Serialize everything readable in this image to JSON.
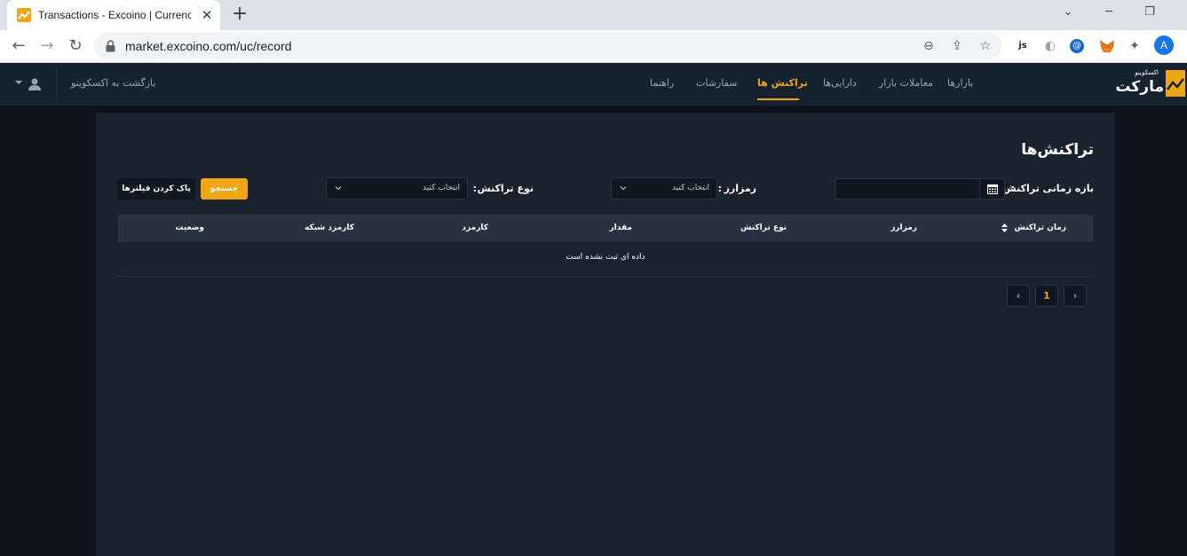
{
  "browser": {
    "tab_title": "Transactions - Excoino | Currency",
    "tab_close": "✕",
    "new_tab": "+",
    "url": "market.excoino.com/uc/record",
    "profile_initial": "A",
    "extensions": [
      "js-extension-icon",
      "circle-extension-icon",
      "at-extension-icon",
      "metamask-icon",
      "puzzle-icon"
    ]
  },
  "header": {
    "brand_small": "اکسکوینو",
    "brand_big": "مارکت",
    "nav": [
      {
        "label": "بازارها",
        "active": false
      },
      {
        "label": "معاملات بازار",
        "active": false
      },
      {
        "label": "دارایی‌ها",
        "active": false
      },
      {
        "label": "تراکنش ها",
        "active": true
      },
      {
        "label": "سفارشات",
        "active": false
      },
      {
        "label": "راهنما",
        "active": false
      }
    ],
    "back_link": "بازگشت به اکسکوینو"
  },
  "page": {
    "title": "تراکنش‌ها",
    "filters": {
      "date_range_label": "بازه زمانی تراکنش",
      "separator": ":",
      "currency_label": "رمزارز",
      "currency_value": "انتخاب کنید",
      "type_label": "نوع تراکنش",
      "type_value": "انتخاب کنید",
      "search_button": "جستجو",
      "clear_button": "پاک کردن فیلترها"
    },
    "table": {
      "columns": [
        "زمان تراکنش",
        "رمزارز",
        "نوع تراکنش",
        "مقدار",
        "کارمزد",
        "کارمزد شبکه",
        "وضعیت"
      ],
      "empty_message": "داده ای ثبت نشده است"
    },
    "pagination": {
      "current_page": "1",
      "prev": "›",
      "next": "‹"
    }
  },
  "colors": {
    "accent": "#f0a614",
    "header_bg": "#172230",
    "panel_bg": "#1a222d",
    "page_bg": "#0d131c"
  }
}
